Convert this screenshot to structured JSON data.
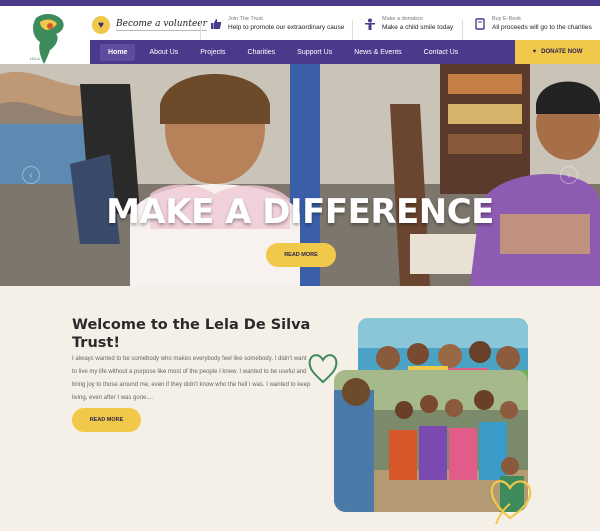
{
  "header": {
    "volunteer_label": "Become a volunteer",
    "items": [
      {
        "small": "Join The Trust",
        "big": "Help to promote our extraordinary cause",
        "icon": "thumbs-up-icon"
      },
      {
        "small": "Make a donation",
        "big": "Make a child smile today",
        "icon": "person-icon"
      },
      {
        "small": "Buy E-Book",
        "big": "All proceeds will go to the charities",
        "icon": "book-icon"
      }
    ]
  },
  "nav": {
    "items": [
      "Home",
      "About Us",
      "Projects",
      "Charities",
      "Support Us",
      "News & Events",
      "Contact Us"
    ],
    "active": "Home",
    "donate_label": "DONATE NOW"
  },
  "hero": {
    "title": "MAKE A DIFFERENCE",
    "button": "READ MORE"
  },
  "welcome": {
    "title": "Welcome to the Lela De Silva Trust!",
    "body": "I always wanted to be somebody who makes everybody feel like somebody. I didn't want to live my life without a purpose like most of the people I knew. I wanted to be useful and bring joy to those around me, even if they didn't know who the hell I was. I wanted to keep living, even after I was gone....",
    "button": "READ MORE"
  },
  "colors": {
    "brand_purple": "#4b3a8c",
    "accent_yellow": "#f0c84a",
    "background": "#f4f0e8",
    "heart_green": "#3d8a5a"
  }
}
